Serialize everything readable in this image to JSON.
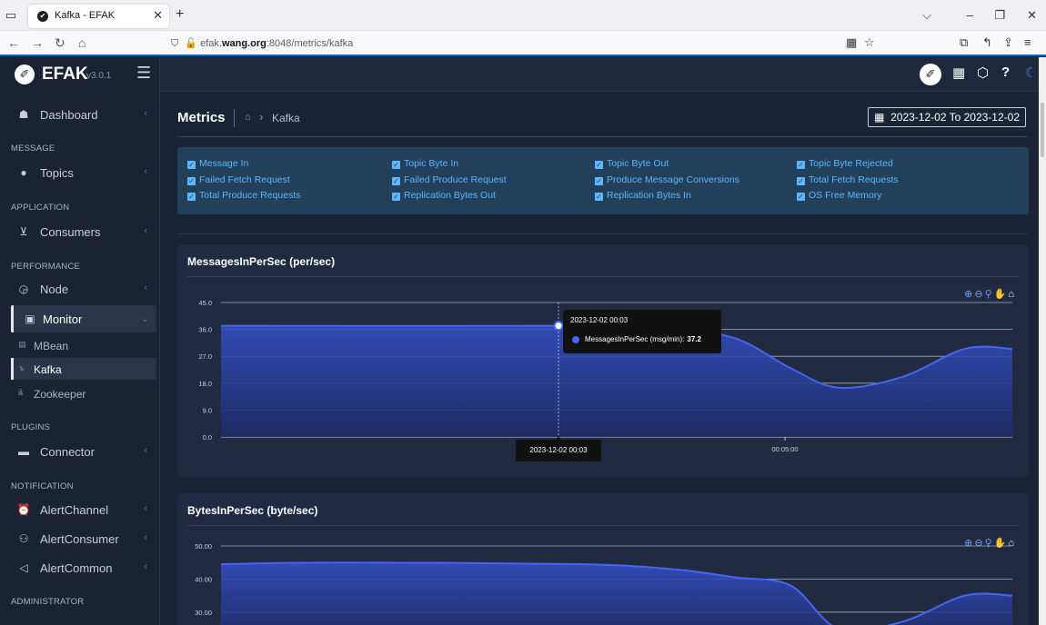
{
  "browser": {
    "tab_title": "Kafka - EFAK",
    "url_prefix": "efak.",
    "url_domain": "wang.org",
    "url_rest": ":8048/metrics/kafka"
  },
  "app": {
    "brand": "EFAK",
    "version": "v3.0.1"
  },
  "sidebar": {
    "dashboard": "Dashboard",
    "sections": {
      "message": "MESSAGE",
      "application": "APPLICATION",
      "performance": "PERFORMANCE",
      "plugins": "PLUGINS",
      "notification": "NOTIFICATION",
      "administrator": "ADMINISTRATOR"
    },
    "topics": "Topics",
    "consumers": "Consumers",
    "node": "Node",
    "monitor": "Monitor",
    "mbean": "MBean",
    "kafka": "Kafka",
    "zookeeper": "Zookeeper",
    "connector": "Connector",
    "alert_channel": "AlertChannel",
    "alert_consumer": "AlertConsumer",
    "alert_common": "AlertCommon"
  },
  "main": {
    "title": "Metrics",
    "breadcrumb": "Kafka",
    "date_range": "2023-12-02 To 2023-12-02",
    "filters": [
      [
        "Message In",
        "Topic Byte In",
        "Topic Byte Out",
        "Topic Byte Rejected"
      ],
      [
        "Failed Fetch Request",
        "Failed Produce Request",
        "Produce Message Conversions",
        "Total Fetch Requests"
      ],
      [
        "Total Produce Requests",
        "Replication Bytes Out",
        "Replication Bytes In",
        "OS Free Memory"
      ]
    ]
  },
  "charts": {
    "messages": {
      "title": "MessagesInPerSec (per/sec)",
      "tooltip_time": "2023-12-02 00:03",
      "tooltip_series": "MessagesInPerSec (msg/min):",
      "tooltip_value": "37.2",
      "axis_pointer_label": "2023-12-02 00:03"
    },
    "bytes": {
      "title": "BytesInPerSec (byte/sec)"
    }
  },
  "chart_data": [
    {
      "type": "area",
      "title": "MessagesInPerSec (per/sec)",
      "series": [
        {
          "name": "MessagesInPerSec (msg/min)",
          "color": "#4566f2"
        }
      ],
      "x_tick_labels": [
        "00:05:00"
      ],
      "y_ticks": [
        "45.0",
        "36.0",
        "27.0",
        "18.0",
        "9.0",
        "0.0"
      ],
      "ylim": [
        0,
        45
      ],
      "points": [
        [
          0,
          37.2
        ],
        [
          0.42,
          37.2
        ],
        [
          0.48,
          37.5
        ],
        [
          0.57,
          36
        ],
        [
          0.65,
          33
        ],
        [
          0.72,
          23
        ],
        [
          0.78,
          16.5
        ],
        [
          0.86,
          20
        ],
        [
          0.94,
          29.5
        ],
        [
          1.0,
          29.5
        ]
      ]
    },
    {
      "type": "area",
      "title": "BytesInPerSec (byte/sec)",
      "series": [
        {
          "color": "#4566f2"
        }
      ],
      "y_ticks": [
        "50.00",
        "40.00",
        "30.00"
      ],
      "ylim": [
        0,
        50
      ],
      "points": [
        [
          0,
          44.5
        ],
        [
          0.15,
          45
        ],
        [
          0.45,
          44.5
        ],
        [
          0.57,
          43
        ],
        [
          0.65,
          40.5
        ],
        [
          0.72,
          38
        ],
        [
          0.78,
          25
        ],
        [
          0.86,
          27
        ],
        [
          0.94,
          35
        ],
        [
          1.0,
          35
        ]
      ]
    }
  ]
}
